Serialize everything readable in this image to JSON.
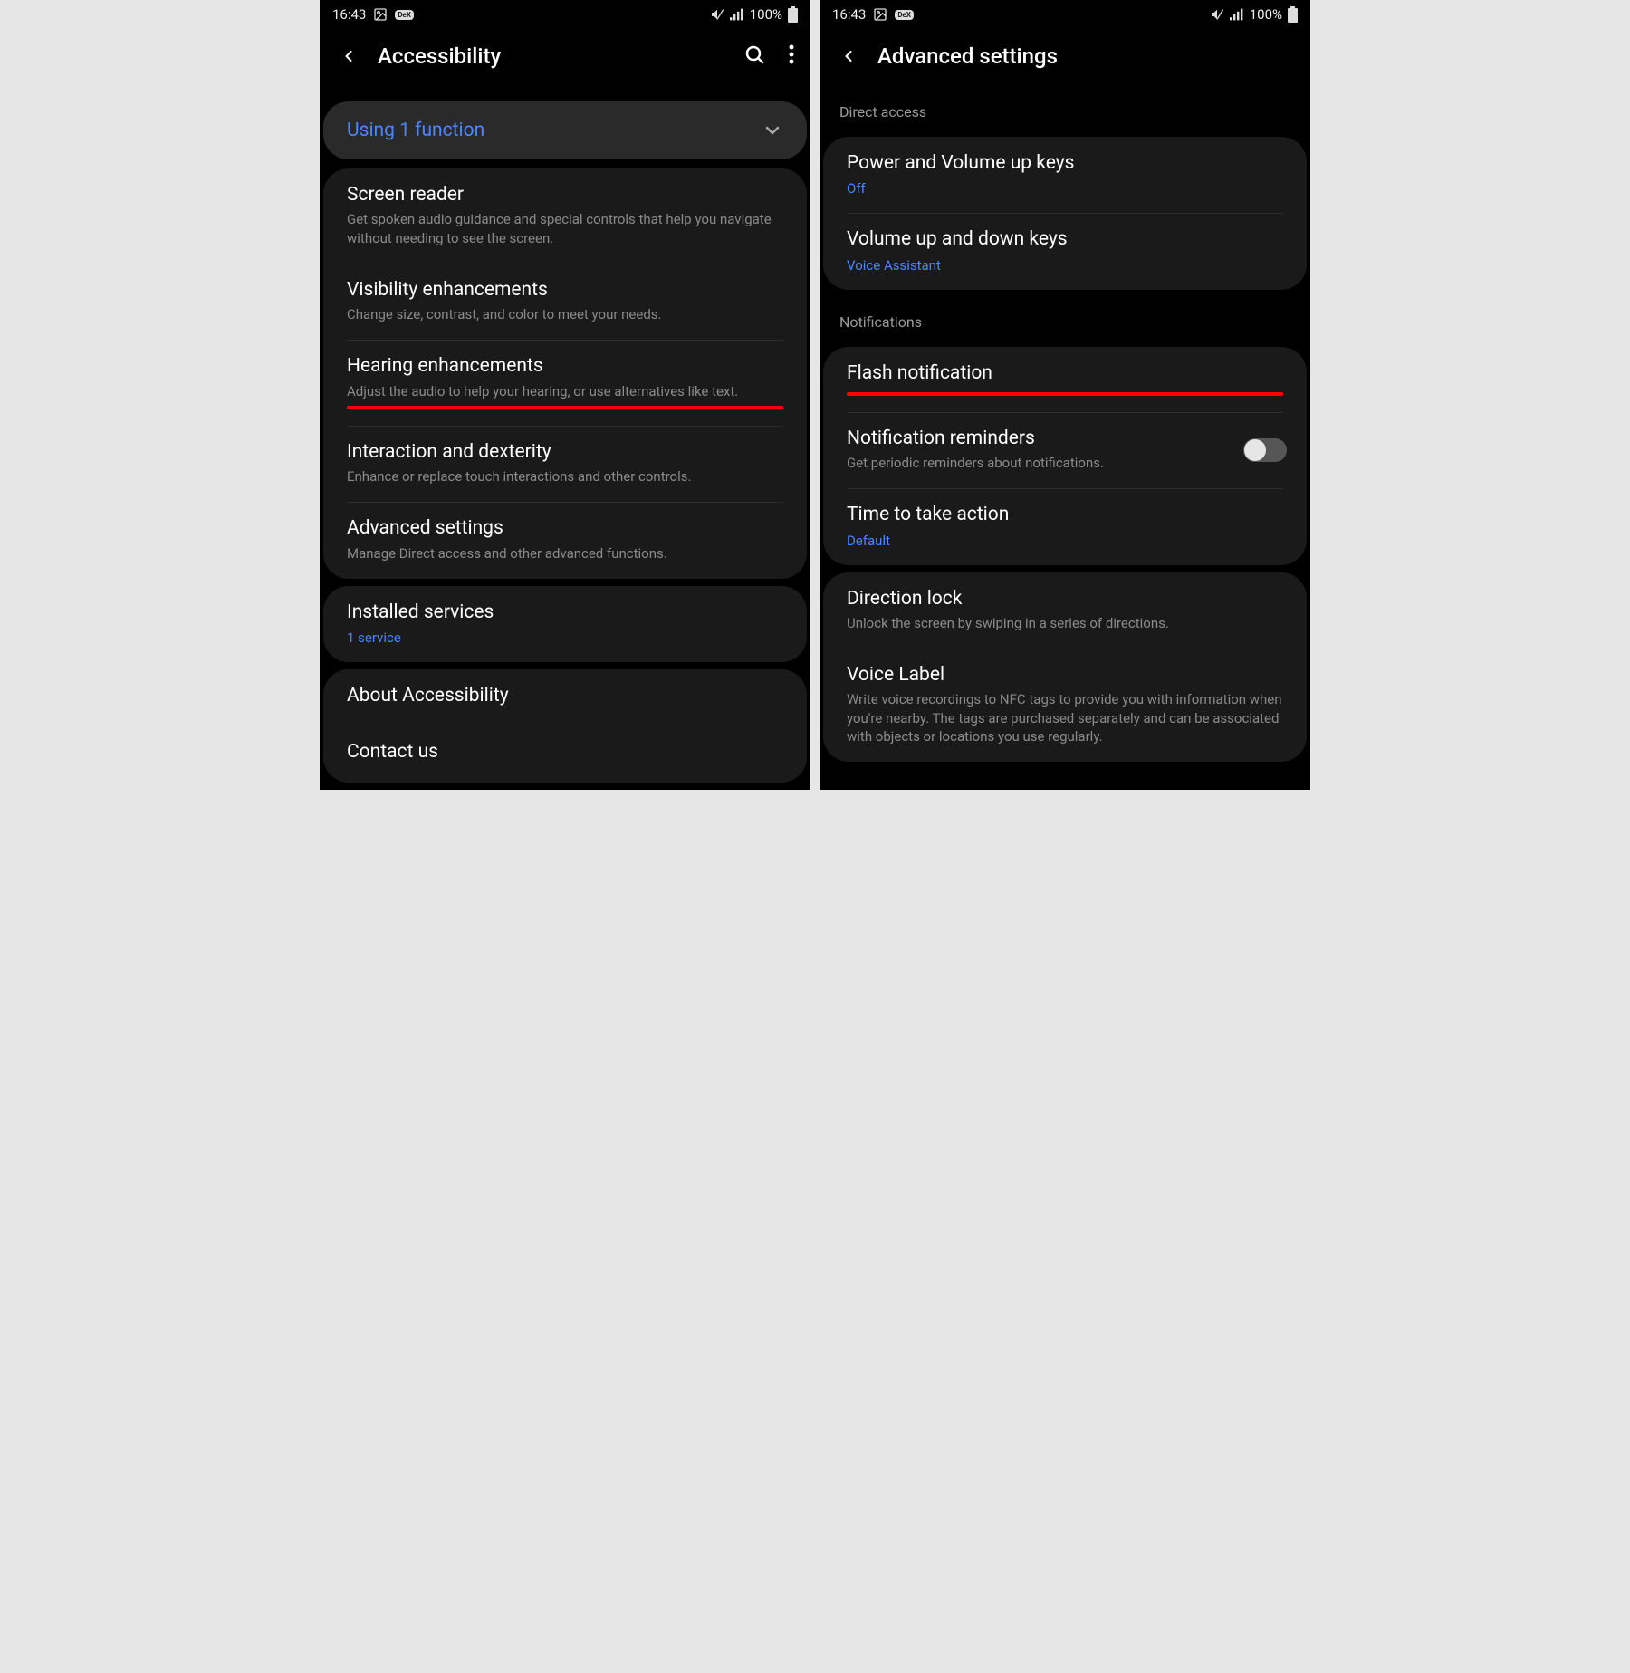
{
  "status": {
    "time": "16:43",
    "battery": "100%"
  },
  "left": {
    "title": "Accessibility",
    "banner": "Using 1 function",
    "rows": {
      "screen_reader": {
        "title": "Screen reader",
        "desc": "Get spoken audio guidance and special controls that help you navigate without needing to see the screen."
      },
      "visibility": {
        "title": "Visibility enhancements",
        "desc": "Change size, contrast, and color to meet your needs."
      },
      "hearing": {
        "title": "Hearing enhancements",
        "desc": "Adjust the audio to help your hearing, or use alternatives like text."
      },
      "interaction": {
        "title": "Interaction and dexterity",
        "desc": "Enhance or replace touch interactions and other controls."
      },
      "advanced": {
        "title": "Advanced settings",
        "desc": "Manage Direct access and other advanced functions."
      },
      "installed": {
        "title": "Installed services",
        "status": "1 service"
      },
      "about": {
        "title": "About Accessibility"
      },
      "contact": {
        "title": "Contact us"
      }
    }
  },
  "right": {
    "title": "Advanced settings",
    "sections": {
      "direct_access": "Direct access",
      "notifications": "Notifications"
    },
    "rows": {
      "power_vol": {
        "title": "Power and Volume up keys",
        "status": "Off"
      },
      "vol_updown": {
        "title": "Volume up and down keys",
        "status": "Voice Assistant"
      },
      "flash": {
        "title": "Flash notification"
      },
      "reminders": {
        "title": "Notification reminders",
        "desc": "Get periodic reminders about notifications."
      },
      "time_action": {
        "title": "Time to take action",
        "status": "Default"
      },
      "direction_lock": {
        "title": "Direction lock",
        "desc": "Unlock the screen by swiping in a series of directions."
      },
      "voice_label": {
        "title": "Voice Label",
        "desc": "Write voice recordings to NFC tags to provide you with information when you're nearby. The tags are purchased separately and can be associated with objects or locations you use regularly."
      }
    }
  }
}
